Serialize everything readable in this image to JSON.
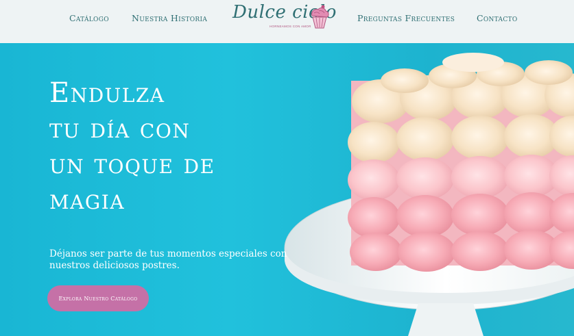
{
  "header": {
    "nav_left": [
      "Catálogo",
      "Nuestra Historia"
    ],
    "nav_right": [
      "Preguntas Frecuentes",
      "Contacto"
    ],
    "logo": {
      "name": "Dulce cielo",
      "tagline": "HORNEAMOS CON AMOR",
      "icon": "cupcake-icon"
    }
  },
  "hero": {
    "headline": [
      "Endulza",
      "tu día con",
      "un toque de",
      "magia"
    ],
    "subtitle": "Déjanos ser parte de tus momentos  especiales con nuestros deliciosos postres.",
    "cta_label": "Explora Nuestro Catálogo"
  },
  "colors": {
    "header_bg": "#eef3f4",
    "nav_text": "#2f6f73",
    "hero_bg": "#1fbad7",
    "cta_bg": "#c571a7",
    "frosting_pink": "#f4a9b2",
    "frosting_cream": "#f6e2c4"
  }
}
